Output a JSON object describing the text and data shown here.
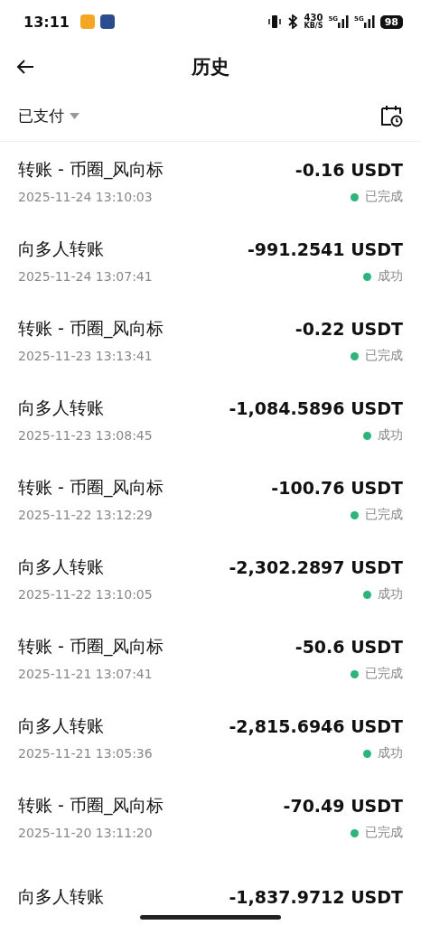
{
  "status_bar": {
    "time": "13:11",
    "speed": "430",
    "speed_unit": "KB/S",
    "network_1": "5G",
    "network_2": "5G",
    "battery": "98"
  },
  "header": {
    "title": "历史"
  },
  "filter": {
    "label": "已支付"
  },
  "transactions": [
    {
      "title": "转账 - 币圈_风向标",
      "amount": "-0.16 USDT",
      "date": "2025-11-24 13:10:03",
      "status": "已完成"
    },
    {
      "title": "向多人转账",
      "amount": "-991.2541 USDT",
      "date": "2025-11-24 13:07:41",
      "status": "成功"
    },
    {
      "title": "转账 - 币圈_风向标",
      "amount": "-0.22 USDT",
      "date": "2025-11-23 13:13:41",
      "status": "已完成"
    },
    {
      "title": "向多人转账",
      "amount": "-1,084.5896 USDT",
      "date": "2025-11-23 13:08:45",
      "status": "成功"
    },
    {
      "title": "转账 - 币圈_风向标",
      "amount": "-100.76 USDT",
      "date": "2025-11-22 13:12:29",
      "status": "已完成"
    },
    {
      "title": "向多人转账",
      "amount": "-2,302.2897 USDT",
      "date": "2025-11-22 13:10:05",
      "status": "成功"
    },
    {
      "title": "转账 - 币圈_风向标",
      "amount": "-50.6 USDT",
      "date": "2025-11-21 13:07:41",
      "status": "已完成"
    },
    {
      "title": "向多人转账",
      "amount": "-2,815.6946 USDT",
      "date": "2025-11-21 13:05:36",
      "status": "成功"
    },
    {
      "title": "转账 - 币圈_风向标",
      "amount": "-70.49 USDT",
      "date": "2025-11-20 13:11:20",
      "status": "已完成"
    },
    {
      "title": "向多人转账",
      "amount": "-1,837.9712 USDT"
    }
  ]
}
